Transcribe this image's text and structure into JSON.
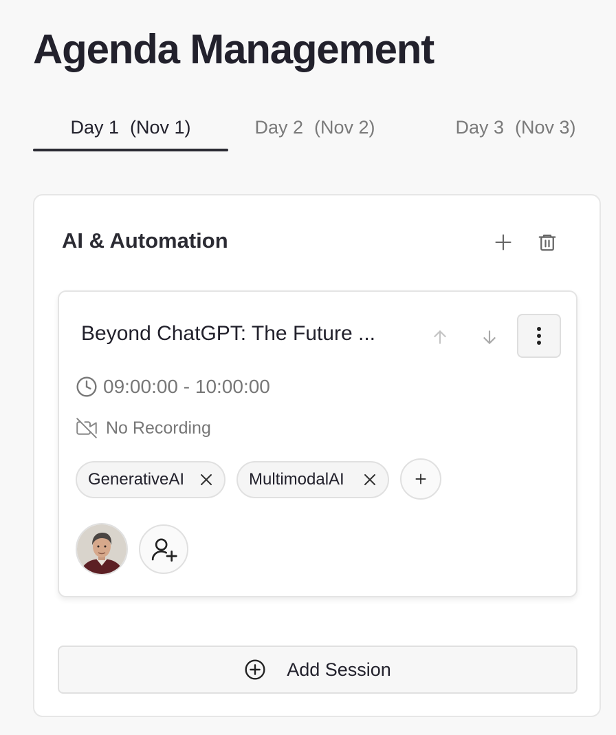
{
  "page": {
    "title": "Agenda Management"
  },
  "tabs": [
    {
      "label": "Day 1",
      "date": "(Nov 1)",
      "active": true
    },
    {
      "label": "Day 2",
      "date": "(Nov 2)",
      "active": false
    },
    {
      "label": "Day 3",
      "date": "(Nov 3)",
      "active": false
    }
  ],
  "track": {
    "title": "AI & Automation",
    "add_icon": "plus-icon",
    "delete_icon": "trash-icon"
  },
  "session": {
    "title": "Beyond ChatGPT: The Future ...",
    "time": "09:00:00 - 10:00:00",
    "recording": "No Recording",
    "tags": [
      "GenerativeAI",
      "MultimodalAI"
    ],
    "icons": {
      "up": "arrow-up-icon",
      "down": "arrow-down-icon",
      "more": "more-vertical-icon",
      "clock": "clock-icon",
      "recording": "video-off-icon",
      "add_speaker": "user-plus-icon"
    }
  },
  "add_session": {
    "label": "Add Session",
    "icon": "plus-circle-icon"
  },
  "colors": {
    "background": "#f8f8f8",
    "text": "#22212c",
    "muted": "#777777",
    "border": "#e4e4e4"
  }
}
